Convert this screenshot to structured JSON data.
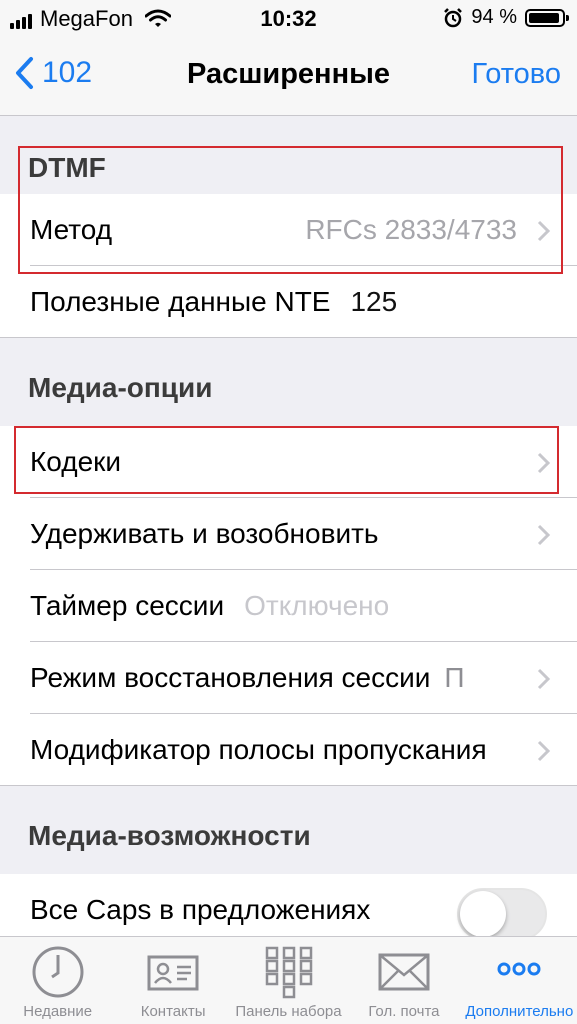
{
  "status_bar": {
    "carrier": "MegaFon",
    "time": "10:32",
    "battery_percent": "94 %",
    "battery_level": 0.94
  },
  "nav": {
    "back_label": "102",
    "title": "Расширенные",
    "done_label": "Готово"
  },
  "sections": {
    "dtmf": {
      "header": "DTMF",
      "method_label": "Метод",
      "method_value": "RFCs 2833/4733",
      "nte_label": "Полезные данные NTE",
      "nte_value": "125"
    },
    "media_options": {
      "header": "Медиа-опции",
      "codecs_label": "Кодеки",
      "hold_resume_label": "Удерживать и возобновить",
      "session_timer_label": "Таймер сессии",
      "session_timer_value": "Отключено",
      "session_recovery_label": "Режим восстановления сессии",
      "session_recovery_value": "П",
      "bandwidth_modifier_label": "Модификатор полосы пропускания"
    },
    "media_capabilities": {
      "header": "Медиа-возможности",
      "all_caps_label": "Все Caps в предложениях",
      "all_caps_on": false
    }
  },
  "tabs": [
    {
      "label": "Недавние",
      "icon": "clock-icon"
    },
    {
      "label": "Контакты",
      "icon": "contact-card-icon"
    },
    {
      "label": "Панель набора",
      "icon": "keypad-icon"
    },
    {
      "label": "Гол. почта",
      "icon": "envelope-icon"
    },
    {
      "label": "Дополнительно",
      "icon": "more-dots-icon",
      "active": true
    }
  ],
  "colors": {
    "accent": "#1b7cf0",
    "highlight_border": "#d42a2f"
  }
}
